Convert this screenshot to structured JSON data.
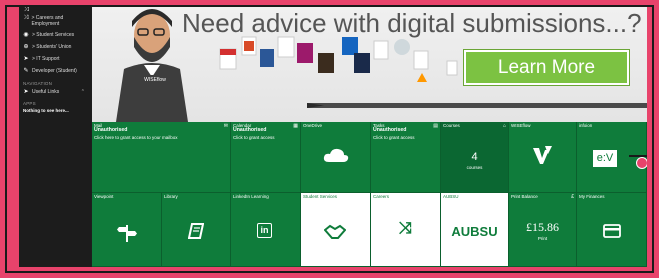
{
  "sidebar": {
    "items": [
      {
        "label": "> Careers and Employment",
        "icon": "shuffle-icon"
      },
      {
        "label": "> Student Services",
        "icon": "eye-icon"
      },
      {
        "label": "> Students' Union",
        "icon": "pointer-icon"
      },
      {
        "label": "> IT Support",
        "icon": "pointer-icon"
      },
      {
        "label": "Developer (Student)",
        "icon": "pencil-icon"
      }
    ],
    "navigation_heading": "NAVIGATION",
    "useful_links": "Useful Links",
    "apps_heading": "APPS",
    "apps_empty": "Nothing to see here..."
  },
  "banner": {
    "title": "Need advice with digital submissions...?",
    "learn_more": "Learn More"
  },
  "tiles": {
    "mail": {
      "name": "Mail",
      "status": "Unauthorised",
      "hint": "Click here to grant access to your mailbox"
    },
    "calendar": {
      "name": "Calendar",
      "status": "Unauthorised",
      "hint": "Click to grant access"
    },
    "onedrive": {
      "name": "OneDrive"
    },
    "tasks": {
      "name": "Tasks",
      "status": "Unauthorised",
      "hint": "Click to grant access"
    },
    "courses": {
      "name": "Courses",
      "count": "4",
      "unit": "courses"
    },
    "wiseflow": {
      "name": "WISEflow"
    },
    "infoion": {
      "name": "infoion",
      "logo": "e:V"
    },
    "viewpoint": {
      "name": "Viewpoint"
    },
    "library": {
      "name": "Library"
    },
    "linkedin": {
      "name": "LinkedIn Learning",
      "logo": "in"
    },
    "student_services": {
      "name": "Student Services"
    },
    "careers": {
      "name": "Careers"
    },
    "aubsu": {
      "name": "AUBSU",
      "logo": "AUBSU"
    },
    "print_balance": {
      "name": "Print Balance",
      "currency": "£",
      "amount": "£15.86",
      "unit": "Print"
    },
    "my_finances": {
      "name": "My Finances"
    }
  },
  "colors": {
    "tile_green": "#0f7c3b",
    "accent_pink": "#e8436b",
    "learn_more_green": "#7cc242"
  }
}
